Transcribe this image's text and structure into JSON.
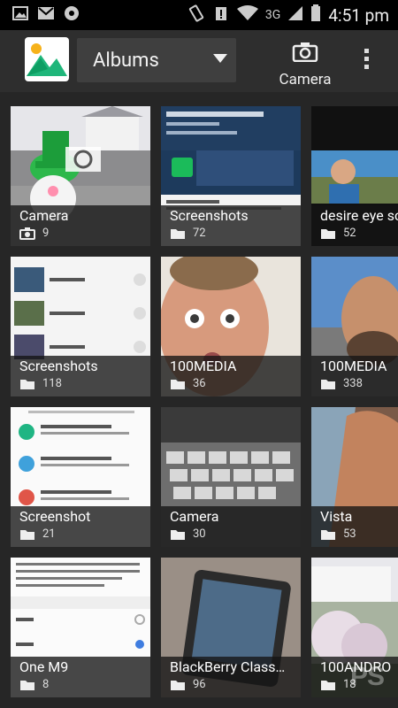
{
  "status": {
    "time": "4:51 pm",
    "network": "3G"
  },
  "actionbar": {
    "title": "Albums",
    "camera_label": "Camera"
  },
  "albums": [
    {
      "name": "Camera",
      "count": "9",
      "icon": "camera-icon"
    },
    {
      "name": "Screenshots",
      "count": "72",
      "icon": "folder-icon"
    },
    {
      "name": "desire eye sc",
      "count": "52",
      "icon": "folder-icon"
    },
    {
      "name": "Screenshots",
      "count": "118",
      "icon": "folder-icon"
    },
    {
      "name": "100MEDIA",
      "count": "36",
      "icon": "folder-icon"
    },
    {
      "name": "100MEDIA",
      "count": "338",
      "icon": "folder-icon"
    },
    {
      "name": "Screenshot",
      "count": "21",
      "icon": "folder-icon"
    },
    {
      "name": "Camera",
      "count": "30",
      "icon": "folder-icon"
    },
    {
      "name": "Vista",
      "count": "53",
      "icon": "folder-icon"
    },
    {
      "name": "One M9",
      "count": "8",
      "icon": "folder-icon"
    },
    {
      "name": "BlackBerry Class…",
      "count": "96",
      "icon": "folder-icon"
    },
    {
      "name": "100ANDRO",
      "count": "18",
      "icon": "folder-icon"
    }
  ],
  "watermark": "PS"
}
